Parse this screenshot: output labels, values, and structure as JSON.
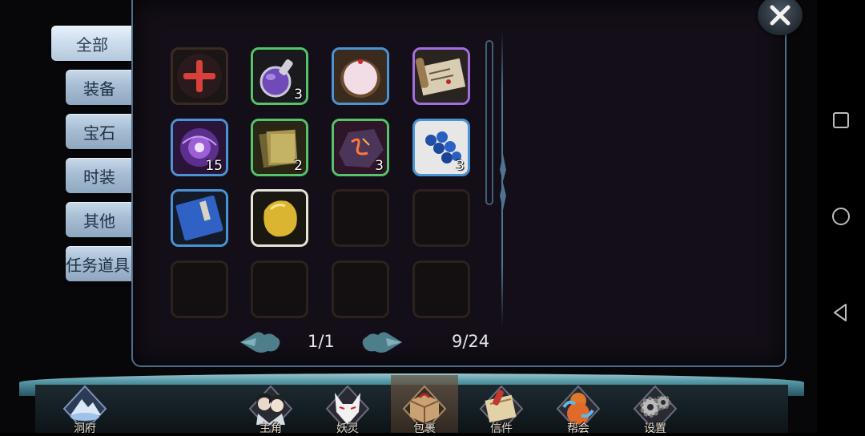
{
  "tabs": [
    {
      "label": "全部",
      "active": true
    },
    {
      "label": "装备",
      "active": false
    },
    {
      "label": "宝石",
      "active": false
    },
    {
      "label": "时装",
      "active": false
    },
    {
      "label": "其他",
      "active": false
    },
    {
      "label": "任务道具",
      "active": false
    }
  ],
  "inventory": {
    "slots": [
      {
        "item": "red-cross-icon",
        "quality": "none",
        "count": ""
      },
      {
        "item": "purple-potion-flask-icon",
        "quality": "green",
        "count": "3"
      },
      {
        "item": "pink-dumpling-icon",
        "quality": "blue",
        "count": ""
      },
      {
        "item": "scroll-map-icon",
        "quality": "purple",
        "count": ""
      },
      {
        "item": "purple-vortex-orb-icon",
        "quality": "blue",
        "count": "15"
      },
      {
        "item": "yellow-manual-books-icon",
        "quality": "green",
        "count": "2"
      },
      {
        "item": "red-rune-stone-icon",
        "quality": "green",
        "count": "3"
      },
      {
        "item": "blue-beads-icon",
        "quality": "blue",
        "count": "3"
      },
      {
        "item": "blue-skill-book-icon",
        "quality": "blue",
        "count": ""
      },
      {
        "item": "gold-ore-icon",
        "quality": "white",
        "count": ""
      },
      {
        "item": "",
        "quality": "empty",
        "count": ""
      },
      {
        "item": "",
        "quality": "empty",
        "count": ""
      },
      {
        "item": "",
        "quality": "empty",
        "count": ""
      },
      {
        "item": "",
        "quality": "empty",
        "count": ""
      },
      {
        "item": "",
        "quality": "empty",
        "count": ""
      },
      {
        "item": "",
        "quality": "empty",
        "count": ""
      }
    ],
    "page": "1/1",
    "capacity": "9/24"
  },
  "bottom_menu": [
    {
      "label": "洞府",
      "icon": "cave-mountain-icon",
      "active": false
    },
    {
      "label": "主角",
      "icon": "heroes-portrait-icon",
      "active": false
    },
    {
      "label": "妖灵",
      "icon": "fox-spirit-icon",
      "active": false
    },
    {
      "label": "包裹",
      "icon": "package-bag-icon",
      "active": true
    },
    {
      "label": "信件",
      "icon": "letter-icon",
      "active": false
    },
    {
      "label": "帮会",
      "icon": "guild-gourd-icon",
      "active": false
    },
    {
      "label": "设置",
      "icon": "gear-settings-icon",
      "active": false
    }
  ],
  "colors": {
    "quality_green": "#54c36a",
    "quality_blue": "#4a93d4",
    "quality_purple": "#a36fe0",
    "quality_white": "#e7e2d8",
    "panel_bg": "#130e17"
  },
  "system_nav": [
    "recent-apps-icon",
    "home-icon",
    "back-icon"
  ]
}
